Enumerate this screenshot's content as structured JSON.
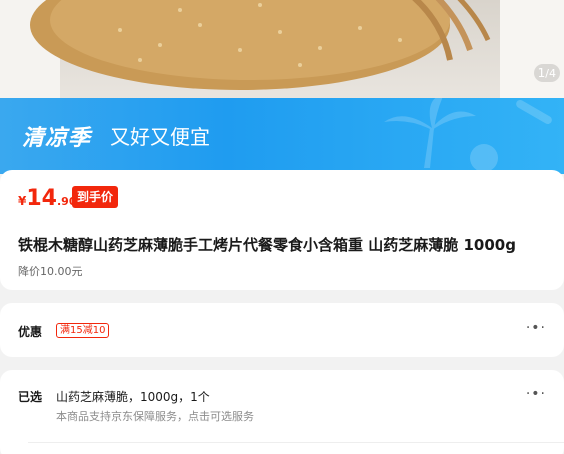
{
  "gallery": {
    "current": "1",
    "total": "/4"
  },
  "banner": {
    "title": "清凉季",
    "subtitle": "又好又便宜"
  },
  "price": {
    "symbol": "¥",
    "integer": "14",
    "decimal": ".90",
    "tag": "到手价"
  },
  "product": {
    "title": "铁棍木糖醇山药芝麻薄脆手工烤片代餐零食小含箱重 山药芝麻薄脆 1000g",
    "previous_price": "降价10.00元"
  },
  "promotion": {
    "label": "优惠",
    "coupon": "满15减10"
  },
  "selection": {
    "label": "已选",
    "value": "山药芝麻薄脆，1000g，1个",
    "note": "本商品支持京东保障服务，点击可选服务"
  },
  "colors": {
    "price_red": "#f2270c",
    "banner_blue": "#1f9cf0"
  }
}
